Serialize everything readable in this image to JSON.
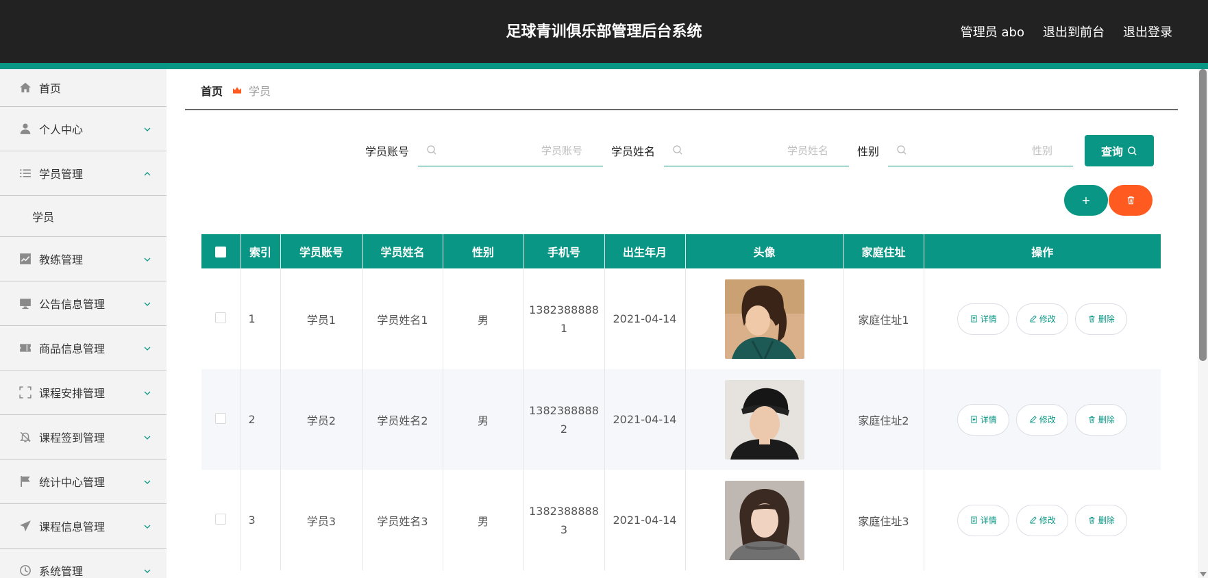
{
  "header": {
    "title": "足球青训俱乐部管理后台系统",
    "admin_label": "管理员 abo",
    "to_front_label": "退出到前台",
    "logout_label": "退出登录"
  },
  "sidebar": {
    "items": [
      {
        "label": "首页",
        "icon": "home-icon"
      },
      {
        "label": "个人中心",
        "icon": "user-icon"
      },
      {
        "label": "学员管理",
        "icon": "list-icon",
        "expanded": true
      },
      {
        "label": "学员",
        "icon": ""
      },
      {
        "label": "教练管理",
        "icon": "chart-icon"
      },
      {
        "label": "公告信息管理",
        "icon": "monitor-icon"
      },
      {
        "label": "商品信息管理",
        "icon": "ticket-icon"
      },
      {
        "label": "课程安排管理",
        "icon": "fullscreen-icon"
      },
      {
        "label": "课程签到管理",
        "icon": "bell-off-icon"
      },
      {
        "label": "统计中心管理",
        "icon": "flag-icon"
      },
      {
        "label": "课程信息管理",
        "icon": "send-icon"
      },
      {
        "label": "系统管理",
        "icon": "clock-icon"
      }
    ]
  },
  "breadcrumb": {
    "home": "首页",
    "current": "学员"
  },
  "search": {
    "fields": [
      {
        "label": "学员账号",
        "placeholder": "学员账号",
        "value": ""
      },
      {
        "label": "学员姓名",
        "placeholder": "学员姓名",
        "value": ""
      },
      {
        "label": "性别",
        "placeholder": "性别",
        "value": ""
      }
    ],
    "query_label": "查询"
  },
  "actions": {
    "add_symbol": "+"
  },
  "table": {
    "columns": [
      "",
      "索引",
      "学员账号",
      "学员姓名",
      "性别",
      "手机号",
      "出生年月",
      "头像",
      "家庭住址",
      "操作"
    ],
    "rows": [
      {
        "index": "1",
        "account": "学员1",
        "name": "学员姓名1",
        "gender": "男",
        "phone_a": "1382388888",
        "phone_b": "1",
        "birth": "2021-04-14",
        "address": "家庭住址1"
      },
      {
        "index": "2",
        "account": "学员2",
        "name": "学员姓名2",
        "gender": "男",
        "phone_a": "1382388888",
        "phone_b": "2",
        "birth": "2021-04-14",
        "address": "家庭住址2"
      },
      {
        "index": "3",
        "account": "学员3",
        "name": "学员姓名3",
        "gender": "男",
        "phone_a": "1382388888",
        "phone_b": "3",
        "birth": "2021-04-14",
        "address": "家庭住址3"
      }
    ],
    "ops": {
      "detail": "详情",
      "edit": "修改",
      "delete": "删除"
    }
  },
  "colors": {
    "accent": "#0a9684",
    "danger": "#ff5a1f",
    "header_bg": "#222222",
    "sidebar_bg": "#f3f3f3"
  }
}
